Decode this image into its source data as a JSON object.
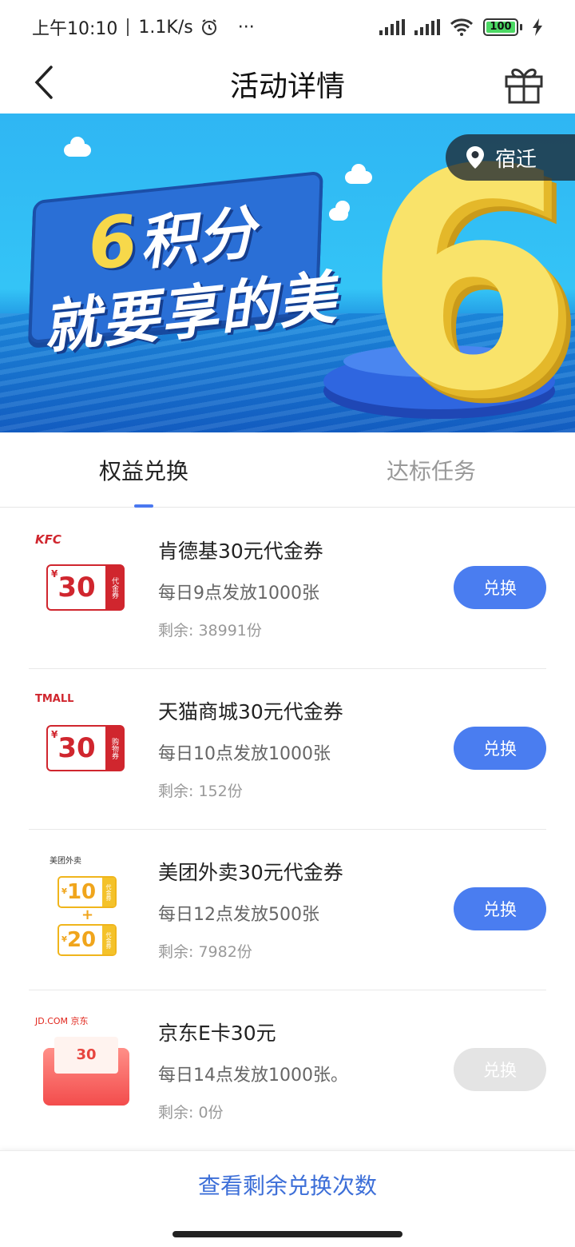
{
  "status_bar": {
    "time": "上午10:10",
    "network_speed": "1.1K/s",
    "alarm_icon": "alarm-clock-icon",
    "more": "···",
    "battery": "100"
  },
  "header": {
    "title": "活动详情",
    "back_icon": "back-arrow-icon",
    "gift_icon": "gift-icon"
  },
  "banner": {
    "slogan_number": "6",
    "slogan_line1": "积分",
    "slogan_line2": "就要享的美",
    "big_number": "6",
    "location": "宿迁"
  },
  "tabs": [
    {
      "label": "权益兑换",
      "active": true
    },
    {
      "label": "达标任务",
      "active": false
    }
  ],
  "items": [
    {
      "name": "肯德基30元代金券",
      "schedule": "每日9点发放1000张",
      "remaining": "剩余: 38991份",
      "button": "兑换",
      "enabled": true,
      "logo": "KFC",
      "coupon_value": "30",
      "coupon_currency": "¥",
      "coupon_stub": "代金券"
    },
    {
      "name": "天猫商城30元代金券",
      "schedule": "每日10点发放1000张",
      "remaining": "剩余: 152份",
      "button": "兑换",
      "enabled": true,
      "logo": "TMALL",
      "coupon_value": "30",
      "coupon_currency": "¥",
      "coupon_stub": "购物券"
    },
    {
      "name": "美团外卖30元代金券",
      "schedule": "每日12点发放500张",
      "remaining": "剩余: 7982份",
      "button": "兑换",
      "enabled": true,
      "logo": "美团外卖",
      "coupon_value_a": "10",
      "coupon_value_b": "20",
      "coupon_plus": "+",
      "coupon_currency": "¥",
      "coupon_stub": "代金券"
    },
    {
      "name": "京东E卡30元",
      "schedule": "每日14点发放1000张。",
      "remaining": "剩余: 0份",
      "button": "兑换",
      "enabled": false,
      "logo": "JD.COM 京东",
      "coupon_value": "30"
    }
  ],
  "footer": {
    "link": "查看剩余兑换次数"
  },
  "colors": {
    "accent": "#4a7df0",
    "link": "#3d6fd8",
    "kfc_red": "#d0262e",
    "meituan_yellow": "#f0b51c",
    "disabled": "#e4e4e4"
  }
}
